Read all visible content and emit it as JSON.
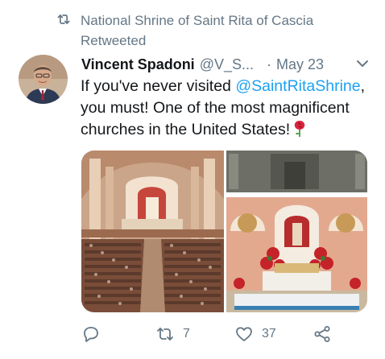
{
  "retweet": {
    "icon": "retweet-icon",
    "by": "National Shrine of Saint Rita of Cascia",
    "label": "Retweeted"
  },
  "tweet": {
    "author_name": "Vincent Spadoni",
    "author_handle": "@V_S...",
    "separator": "·",
    "date": "May 23",
    "text_before": "If you've never visited ",
    "mention": "@SaintRitaShrine",
    "text_after": ", you must! One of the most magnificent churches in the United States!",
    "emoji": "rose-icon",
    "media": [
      "church-interior-photo",
      "church-altar-photo"
    ]
  },
  "actions": {
    "reply_icon": "reply-icon",
    "retweet_icon": "retweet-icon",
    "retweet_count": "7",
    "like_icon": "heart-icon",
    "like_count": "37",
    "share_icon": "share-icon"
  },
  "colors": {
    "secondary_text": "#657786",
    "link": "#1da1f2",
    "primary_text": "#14171a"
  }
}
